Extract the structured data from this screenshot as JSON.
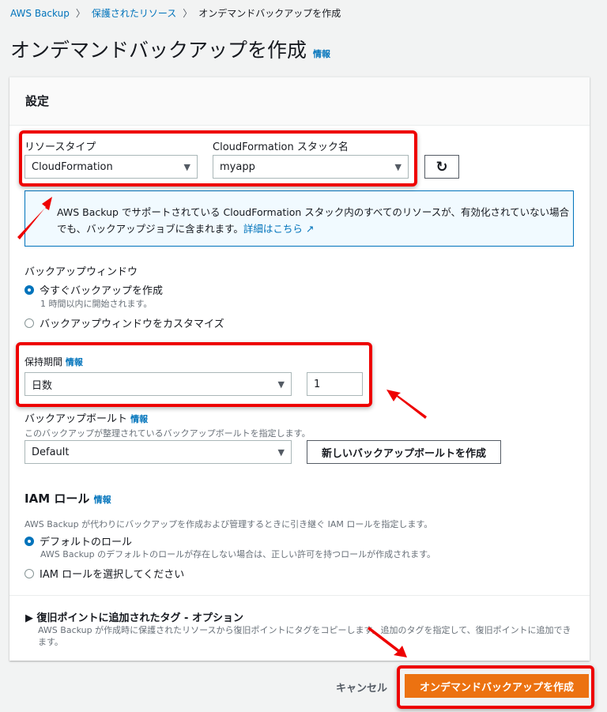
{
  "breadcrumb": {
    "items": [
      "AWS Backup",
      "保護されたリソース",
      "オンデマンドバックアップを作成"
    ],
    "separator": "〉"
  },
  "page": {
    "title": "オンデマンドバックアップを作成",
    "info": "情報"
  },
  "settings": {
    "title": "設定",
    "resource_type": {
      "label": "リソースタイプ",
      "value": "CloudFormation"
    },
    "stack_name": {
      "label": "CloudFormation スタック名",
      "value": "myapp"
    },
    "refresh_icon": "↻",
    "info_text": "AWS Backup でサポートされている CloudFormation スタック内のすべてのリソースが、有効化されていない場合でも、バックアップジョブに含まれます。",
    "info_link": "詳細はこちら",
    "backup_window": {
      "label": "バックアップウィンドウ",
      "option1": "今すぐバックアップを作成",
      "option1_desc": "1 時間以内に開始されます。",
      "option2": "バックアップウィンドウをカスタマイズ"
    },
    "retention": {
      "label": "保持期間",
      "info": "情報",
      "unit": "日数",
      "value": "1"
    },
    "vault": {
      "label": "バックアップボールト",
      "info": "情報",
      "desc": "このバックアップが整理されているバックアップボールトを指定します。",
      "value": "Default",
      "create_button": "新しいバックアップボールトを作成"
    },
    "iam": {
      "title": "IAM ロール",
      "info": "情報",
      "desc": "AWS Backup が代わりにバックアップを作成および管理するときに引き継ぐ IAM ロールを指定します。",
      "option1": "デフォルトのロール",
      "option1_desc": "AWS Backup のデフォルトのロールが存在しない場合は、正しい許可を持つロールが作成されます。",
      "option2": "IAM ロールを選択してください"
    },
    "tags": {
      "title": "復旧ポイントに追加されたタグ - オプション",
      "desc": "AWS Backup が作成時に保護されたリソースから復旧ポイントにタグをコピーします。追加のタグを指定して、復旧ポイントに追加できます。"
    }
  },
  "footer": {
    "cancel": "キャンセル",
    "submit": "オンデマンドバックアップを作成"
  },
  "colors": {
    "accent": "#ec7211",
    "link": "#0073bb",
    "annotation": "#ee0000"
  }
}
